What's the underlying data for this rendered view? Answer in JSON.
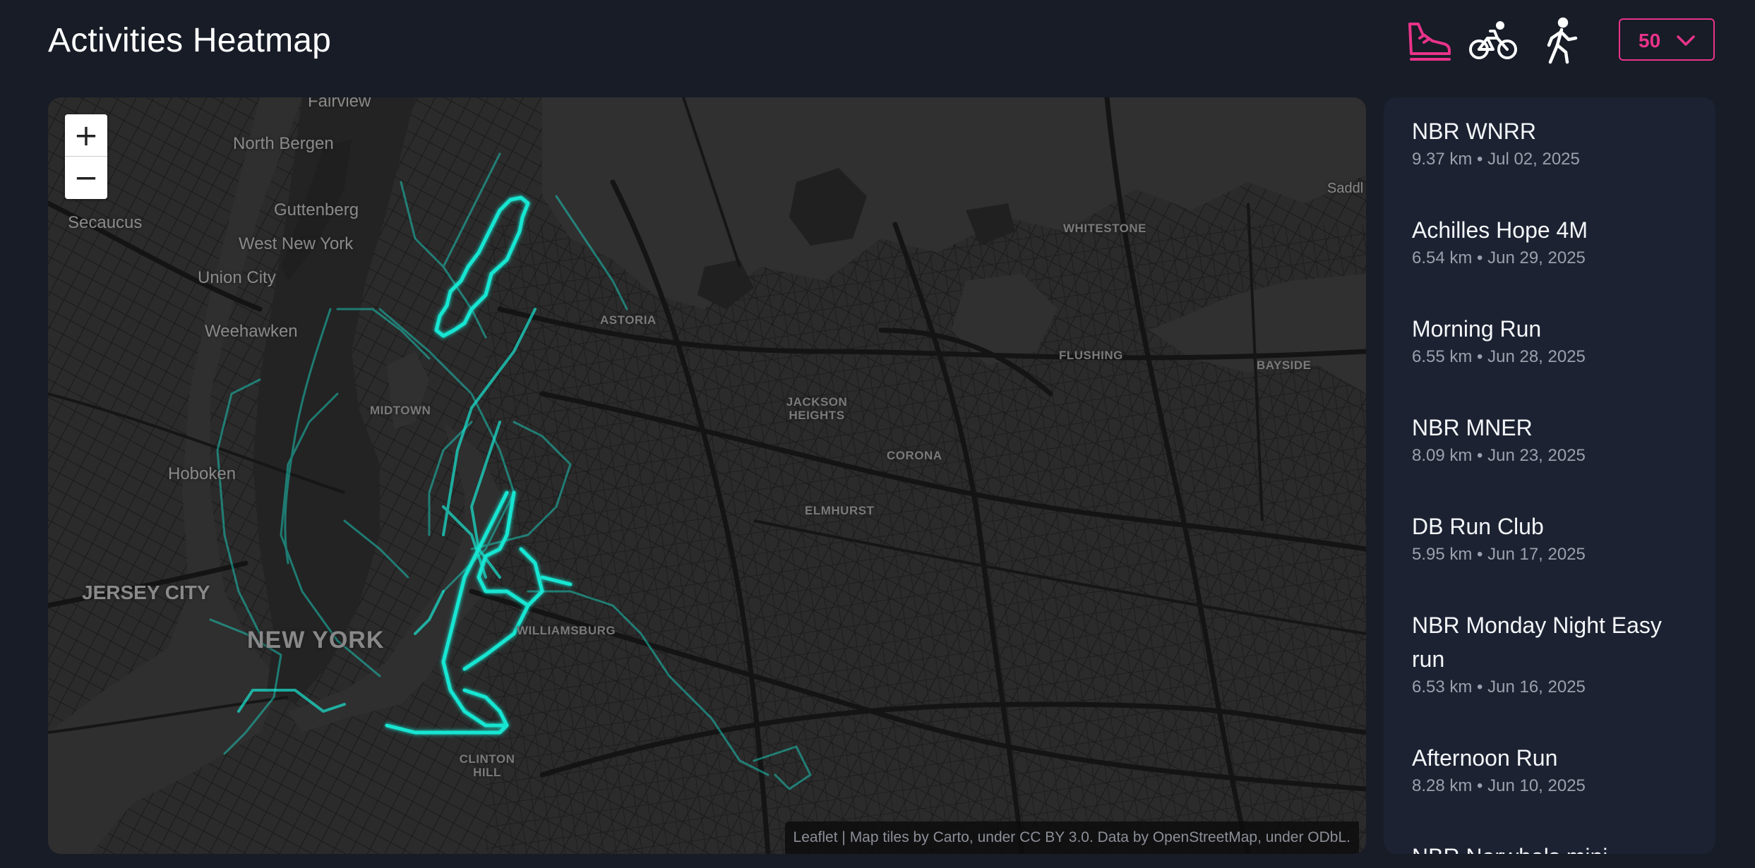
{
  "header": {
    "title": "Activities Heatmap"
  },
  "activity_types": [
    {
      "name": "run-shoe-icon",
      "color": "#e9338a",
      "active": true
    },
    {
      "name": "bike-icon",
      "color": "#ffffff",
      "active": false
    },
    {
      "name": "walk-icon",
      "color": "#ffffff",
      "active": false
    }
  ],
  "count_select": {
    "value": "50",
    "icon": "chevron-down-icon",
    "color": "#e9338a"
  },
  "map": {
    "zoom_in": "+",
    "zoom_out": "−",
    "attribution": "Leaflet | Map tiles by Carto, under CC BY 3.0. Data by OpenStreetMap, under ODbL.",
    "route_color": "#19e6d2",
    "labels": {
      "fairview": "Fairview",
      "north_bergen": "North Bergen",
      "secaucus": "Secaucus",
      "guttenberg": "Guttenberg",
      "west_new_york": "West New York",
      "union_city": "Union City",
      "weehawken": "Weehawken",
      "midtown": "MIDTOWN",
      "hoboken": "Hoboken",
      "jersey_city": "JERSEY CITY",
      "new_york": "NEW YORK",
      "astoria": "ASTORIA",
      "whitestone": "WHITESTONE",
      "flushing": "FLUSHING",
      "bayside": "BAYSIDE",
      "jackson_heights": "JACKSON HEIGHTS",
      "corona": "CORONA",
      "elmhurst": "ELMHURST",
      "williamsburg": "WILLIAMSBURG",
      "clinton_hill": "CLINTON HILL",
      "saddle": "Saddl"
    }
  },
  "activities": [
    {
      "name": "NBR WNRR",
      "meta": "9.37 km • Jul 02, 2025"
    },
    {
      "name": "Achilles Hope 4M",
      "meta": "6.54 km • Jun 29, 2025"
    },
    {
      "name": "Morning Run",
      "meta": "6.55 km • Jun 28, 2025"
    },
    {
      "name": "NBR MNER",
      "meta": "8.09 km • Jun 23, 2025"
    },
    {
      "name": "DB Run Club",
      "meta": "5.95 km • Jun 17, 2025"
    },
    {
      "name": "NBR Monday Night Easy run",
      "meta": "6.53 km • Jun 16, 2025"
    },
    {
      "name": "Afternoon Run",
      "meta": "8.28 km • Jun 10, 2025"
    },
    {
      "name": "NBR Narwhals mini",
      "meta": ""
    }
  ]
}
